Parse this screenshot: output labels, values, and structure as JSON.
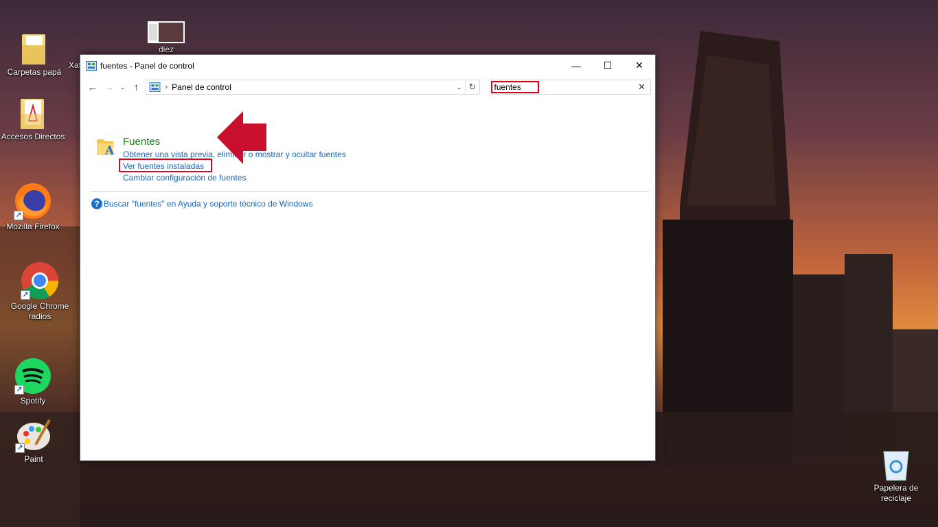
{
  "desktop": {
    "icons": [
      {
        "label": "Carpetas papá",
        "icon": "folder-icon"
      },
      {
        "label": "Xat",
        "icon": "notepad-icon"
      },
      {
        "label": "diez",
        "icon": "image-thumbnail-icon"
      },
      {
        "label": "Accesos Directos",
        "icon": "pdf-folder-icon"
      },
      {
        "label": "Mozilla Firefox",
        "icon": "firefox-icon"
      },
      {
        "label": "Google Chrome radios",
        "icon": "chrome-icon"
      },
      {
        "label": "Spotify",
        "icon": "spotify-icon"
      },
      {
        "label": "Paint",
        "icon": "paint-icon"
      },
      {
        "label": "Papelera de reciclaje",
        "icon": "recycle-bin-icon"
      }
    ]
  },
  "window": {
    "title": "fuentes - Panel de control",
    "controls": {
      "minimize": "—",
      "maximize": "☐",
      "close": "✕"
    },
    "nav": {
      "back": "←",
      "forward": "→",
      "recent": "⌄",
      "up": "↑"
    },
    "address": {
      "separator": "›",
      "crumb": "Panel de control",
      "dropdown": "⌄",
      "refresh": "↻"
    },
    "search": {
      "value": "fuentes",
      "clear": "✕"
    },
    "result": {
      "title": "Fuentes",
      "links": [
        "Obtener una vista previa, eliminar o mostrar y ocultar fuentes",
        "Ver fuentes instaladas",
        "Cambiar configuración de fuentes"
      ]
    },
    "help": {
      "icon": "?",
      "text": "Buscar \"fuentes\" en Ayuda y soporte técnico de Windows"
    }
  },
  "colors": {
    "annotation_red": "#e0001a",
    "arrow_red": "#c8102e",
    "link_blue": "#1565c0",
    "title_green": "#1e7d1e"
  }
}
